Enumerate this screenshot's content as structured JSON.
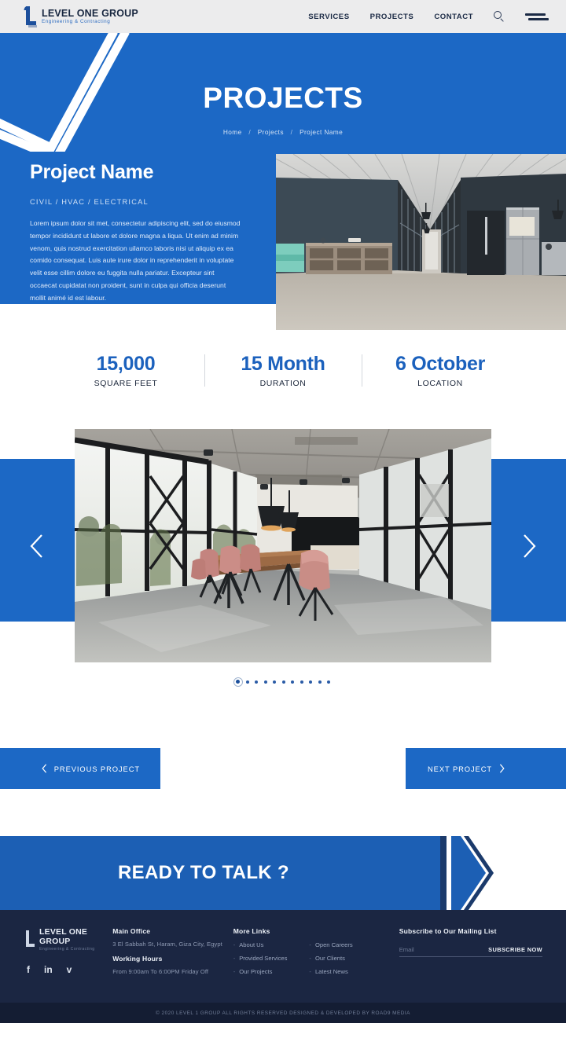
{
  "header": {
    "logo": {
      "title": "LEVEL ONE GROUP",
      "subtitle": "Engineering & Contracting"
    },
    "nav": [
      {
        "label": "SERVICES"
      },
      {
        "label": "PROJECTS"
      },
      {
        "label": "CONTACT"
      }
    ],
    "search_icon": "search-icon",
    "menu_icon": "hamburger-menu-icon"
  },
  "hero": {
    "title": "PROJECTS",
    "breadcrumb": {
      "home": "Home",
      "section": "Projects",
      "current": "Project Name",
      "separator": "/"
    }
  },
  "project": {
    "name": "Project Name",
    "tags": "CIVIL  /  HVAC  /  ELECTRICAL",
    "description": "Lorem ipsum dolor sit met, consectetur adipiscing elit, sed do eiusmod tempor incididunt ut labore et dolore magna a liqua. Ut enim ad minim venom, quis nostrud exercitation uilamco laboris nisi ut aliquip ex ea comido consequat. Luis aute irure dolor in reprehenderit in voluptate velit esse cillim dolore eu fuggita nulla pariatur. Excepteur sint occaecat cupidatat non proident, sunt in culpa qui officia deserunt mollit animé id est labour."
  },
  "stats": [
    {
      "value": "15,000",
      "label": "SQUARE FEET"
    },
    {
      "value": "15 Month",
      "label": "DURATION"
    },
    {
      "value": "6 October",
      "label": "LOCATION"
    }
  ],
  "carousel": {
    "prev_icon": "chevron-left-icon",
    "next_icon": "chevron-right-icon",
    "total_dots": 11,
    "active_dot": 1
  },
  "project_nav": {
    "previous": "PREVIOUS PROJECT",
    "next": "NEXT PROJECT"
  },
  "cta": {
    "title": "READY TO TALK ?"
  },
  "footer": {
    "logo": {
      "title": "LEVEL ONE GROUP",
      "subtitle": "Engineering & Contracting"
    },
    "socials": [
      {
        "name": "facebook-icon",
        "glyph": "f"
      },
      {
        "name": "linkedin-icon",
        "glyph": "in"
      },
      {
        "name": "twitter-icon",
        "glyph": "ᴠ"
      }
    ],
    "office": {
      "heading": "Main Office",
      "address": "3 El Sabbah St, Haram, Giza City, Egypt",
      "hours_heading": "Working Hours",
      "hours": "From 9:00am To 6:00PM Friday Off"
    },
    "links": {
      "heading": "More Links",
      "col1": [
        {
          "label": "About Us"
        },
        {
          "label": "Provided Services"
        },
        {
          "label": "Our Projects"
        }
      ],
      "col2": [
        {
          "label": "Open Careers"
        },
        {
          "label": "Our Clients"
        },
        {
          "label": "Latest News"
        }
      ]
    },
    "newsletter": {
      "heading": "Subscribe to Our Mailing List",
      "placeholder": "Email",
      "value": "",
      "button": "SUBSCRIBE NOW"
    },
    "copyright": "© 2020  LEVEL 1 GROUP   ALL RIGHTS RESERVED  DESIGNED & DEVELOPED BY ROAD9 MEDIA"
  },
  "colors": {
    "brand_blue": "#1c68c5",
    "deep_blue": "#1b61bd",
    "footer_navy": "#1b2642",
    "copyright_navy": "#141d33",
    "topbar_grey": "#ececed"
  }
}
